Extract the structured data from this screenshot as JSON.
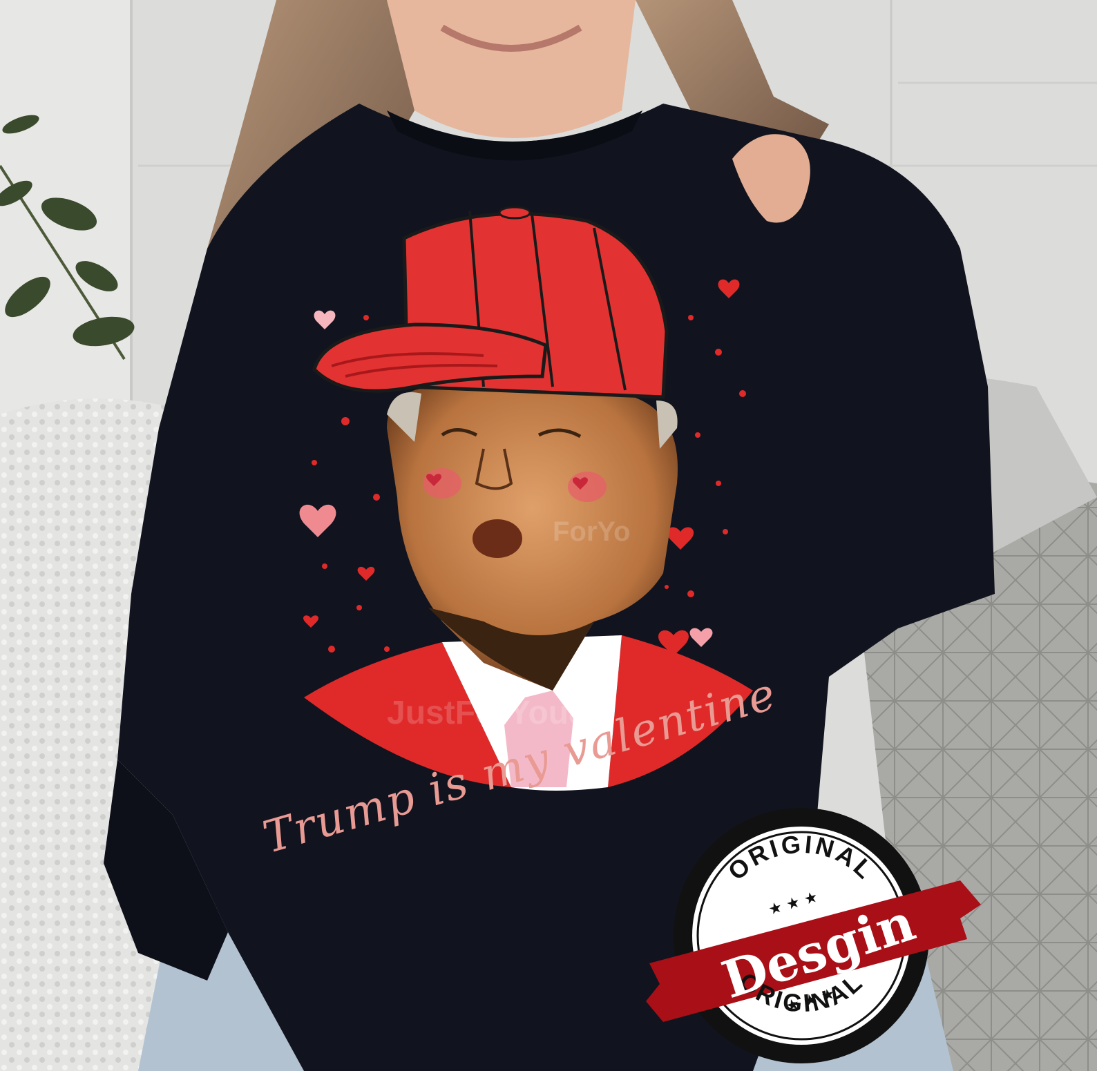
{
  "photo": {
    "subject": "woman wearing sweatshirt",
    "sweatshirt_color": "#11141f",
    "accent_red": "#e02a2a",
    "accent_pink": "#e89a93"
  },
  "print": {
    "script_text": "Trump is my valentine",
    "watermark": "JustForYou87",
    "watermark_partial": "ForYo"
  },
  "badge": {
    "top_text": "ORIGINAL",
    "bottom_text": "ORIGINAL",
    "ribbon_text": "Desgin",
    "stars_top": "★ ★ ★",
    "stars_bottom": "★ ★ ★"
  }
}
